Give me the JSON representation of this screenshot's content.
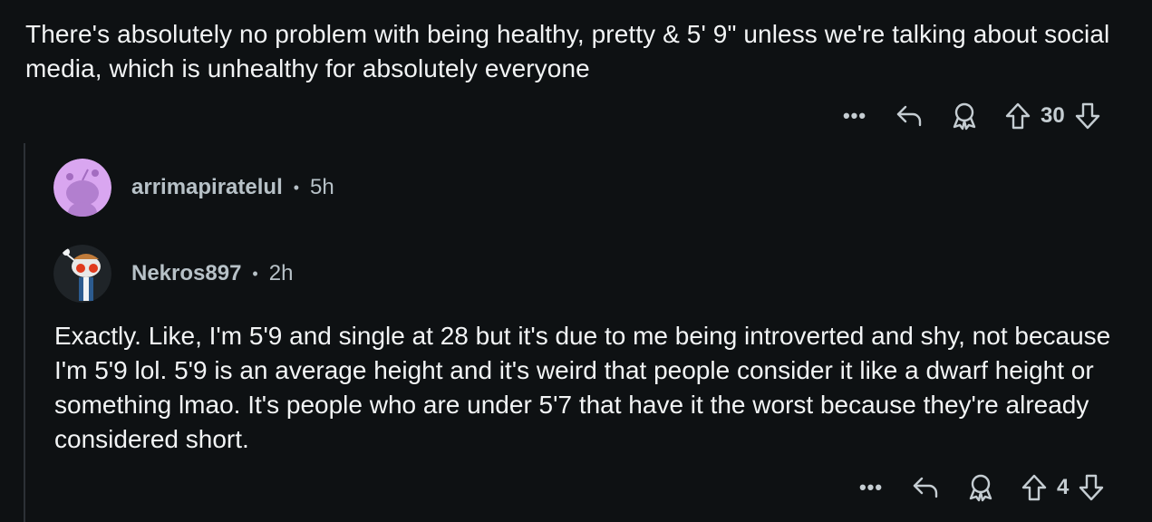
{
  "parent_comment": {
    "body": "There's absolutely no problem with being healthy, pretty & 5' 9\" unless we're talking about social media, which is unhealthy for absolutely everyone",
    "actions": {
      "more_label": "•••",
      "vote_count": "30",
      "icons": [
        "more-icon",
        "reply-icon",
        "award-icon",
        "upvote-icon",
        "downvote-icon"
      ]
    }
  },
  "replies": [
    {
      "username": "arrimapiratelul",
      "separator": "•",
      "time": "5h",
      "avatar": "snoo-avatar-purple"
    },
    {
      "username": "Nekros897",
      "separator": "•",
      "time": "2h",
      "avatar": "snoo-avatar-custom",
      "body": "Exactly. Like, I'm 5'9 and single at 28 but it's due to me being introverted and shy, not because I'm 5'9 lol. 5'9 is an average height and it's weird that people consider it like a dwarf height or something lmao. It's people who are under 5'7 that have it the worst because they're already considered short.",
      "actions": {
        "more_label": "•••",
        "vote_count": "4"
      }
    }
  ],
  "colors": {
    "background": "#0e1113",
    "text": "#f2f4f5",
    "meta_text": "#b7c1c7",
    "thread_line": "#2c3136",
    "avatar_purple": "#d9a6f0"
  }
}
